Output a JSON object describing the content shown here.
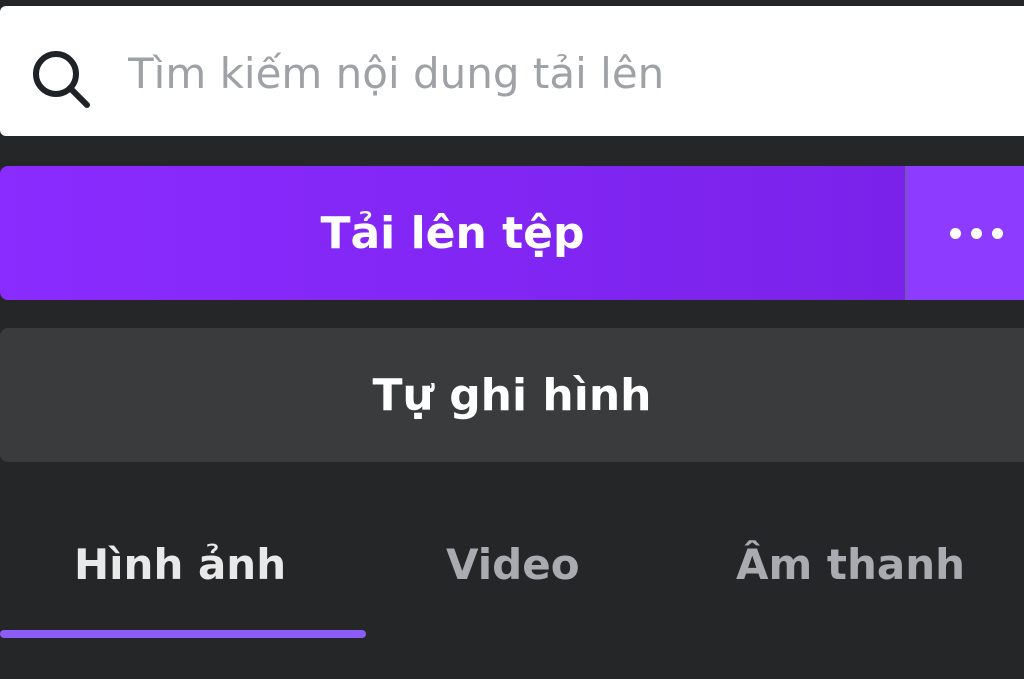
{
  "search": {
    "placeholder": "Tìm kiếm nội dung tải lên",
    "value": "",
    "icon": "search-icon"
  },
  "upload": {
    "label": "Tải lên tệp",
    "more_icon": "more-horizontal-icon"
  },
  "record": {
    "label": "Tự ghi hình"
  },
  "tabs": [
    {
      "label": "Hình ảnh",
      "active": true
    },
    {
      "label": "Video",
      "active": false
    },
    {
      "label": "Âm thanh",
      "active": false
    }
  ],
  "colors": {
    "accent": "#8a2bff",
    "accent_secondary": "#8d3cff",
    "tab_indicator": "#8b5cf6",
    "background": "#252627",
    "secondary_button": "#3a3b3d"
  }
}
